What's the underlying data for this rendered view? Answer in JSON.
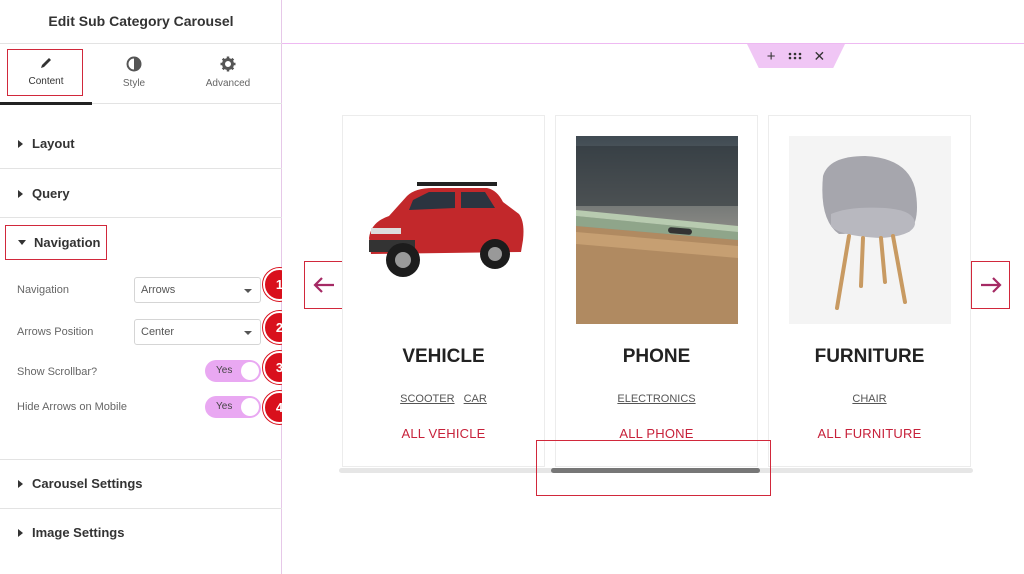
{
  "panel": {
    "title": "Edit Sub Category Carousel",
    "tabs": [
      {
        "label": "Content",
        "icon": "pencil-icon"
      },
      {
        "label": "Style",
        "icon": "contrast-icon"
      },
      {
        "label": "Advanced",
        "icon": "gear-icon"
      }
    ],
    "sections": {
      "layout": "Layout",
      "query": "Query",
      "navigation": "Navigation",
      "carousel_settings": "Carousel Settings",
      "image_settings": "Image Settings"
    },
    "controls": {
      "navigation_label": "Navigation",
      "navigation_value": "Arrows",
      "arrows_position_label": "Arrows Position",
      "arrows_position_value": "Center",
      "show_scrollbar_label": "Show Scrollbar?",
      "show_scrollbar_value": "Yes",
      "hide_arrows_label": "Hide Arrows on Mobile",
      "hide_arrows_value": "Yes"
    },
    "markers": [
      "1",
      "2",
      "3",
      "4"
    ]
  },
  "canvas": {
    "handle_icons": [
      "plus-icon",
      "drag-icon",
      "close-icon"
    ],
    "cards": [
      {
        "title": "VEHICLE",
        "subs": [
          "SCOOTER",
          "CAR"
        ],
        "all": "ALL VEHICLE"
      },
      {
        "title": "PHONE",
        "subs": [
          "ELECTRONICS"
        ],
        "all": "ALL PHONE"
      },
      {
        "title": "FURNITURE",
        "subs": [
          "CHAIR"
        ],
        "all": "ALL FURNITURE"
      }
    ]
  },
  "colors": {
    "accent_red": "#c7213a",
    "marker_red": "#d9101c",
    "toggle_pink": "#e9a8f2",
    "canvas_border": "#eeb9f2"
  }
}
